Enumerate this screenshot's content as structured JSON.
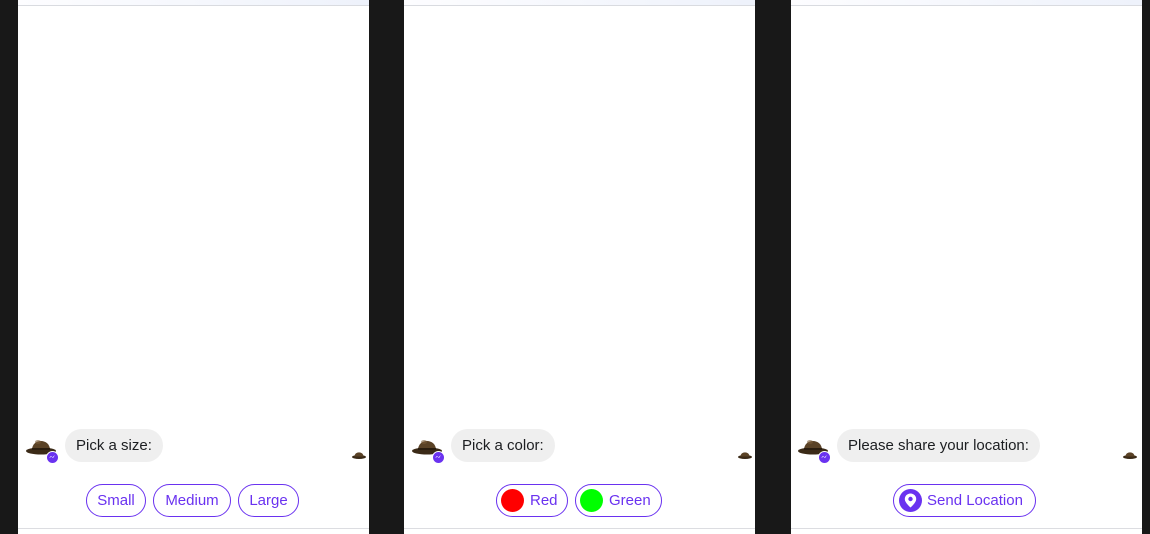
{
  "colors": {
    "accent": "#6a32f0",
    "bubble_bg": "#efefef",
    "background": "#181818",
    "red_swatch": "#ff0000",
    "green_swatch": "#00ff00"
  },
  "panels": [
    {
      "avatar_icon": "bowler-hat-icon",
      "badge_icon": "messenger-badge-icon",
      "message": "Pick a size:",
      "quick_replies": [
        {
          "label": "Small"
        },
        {
          "label": "Medium"
        },
        {
          "label": "Large"
        }
      ]
    },
    {
      "avatar_icon": "bowler-hat-icon",
      "badge_icon": "messenger-badge-icon",
      "message": "Pick a color:",
      "quick_replies": [
        {
          "label": "Red",
          "swatch": "#ff0000"
        },
        {
          "label": "Green",
          "swatch": "#00ff00"
        }
      ]
    },
    {
      "avatar_icon": "bowler-hat-icon",
      "badge_icon": "messenger-badge-icon",
      "message": "Please share your location:",
      "quick_replies": [
        {
          "label": "Send Location",
          "icon": "location-pin-icon"
        }
      ]
    }
  ]
}
